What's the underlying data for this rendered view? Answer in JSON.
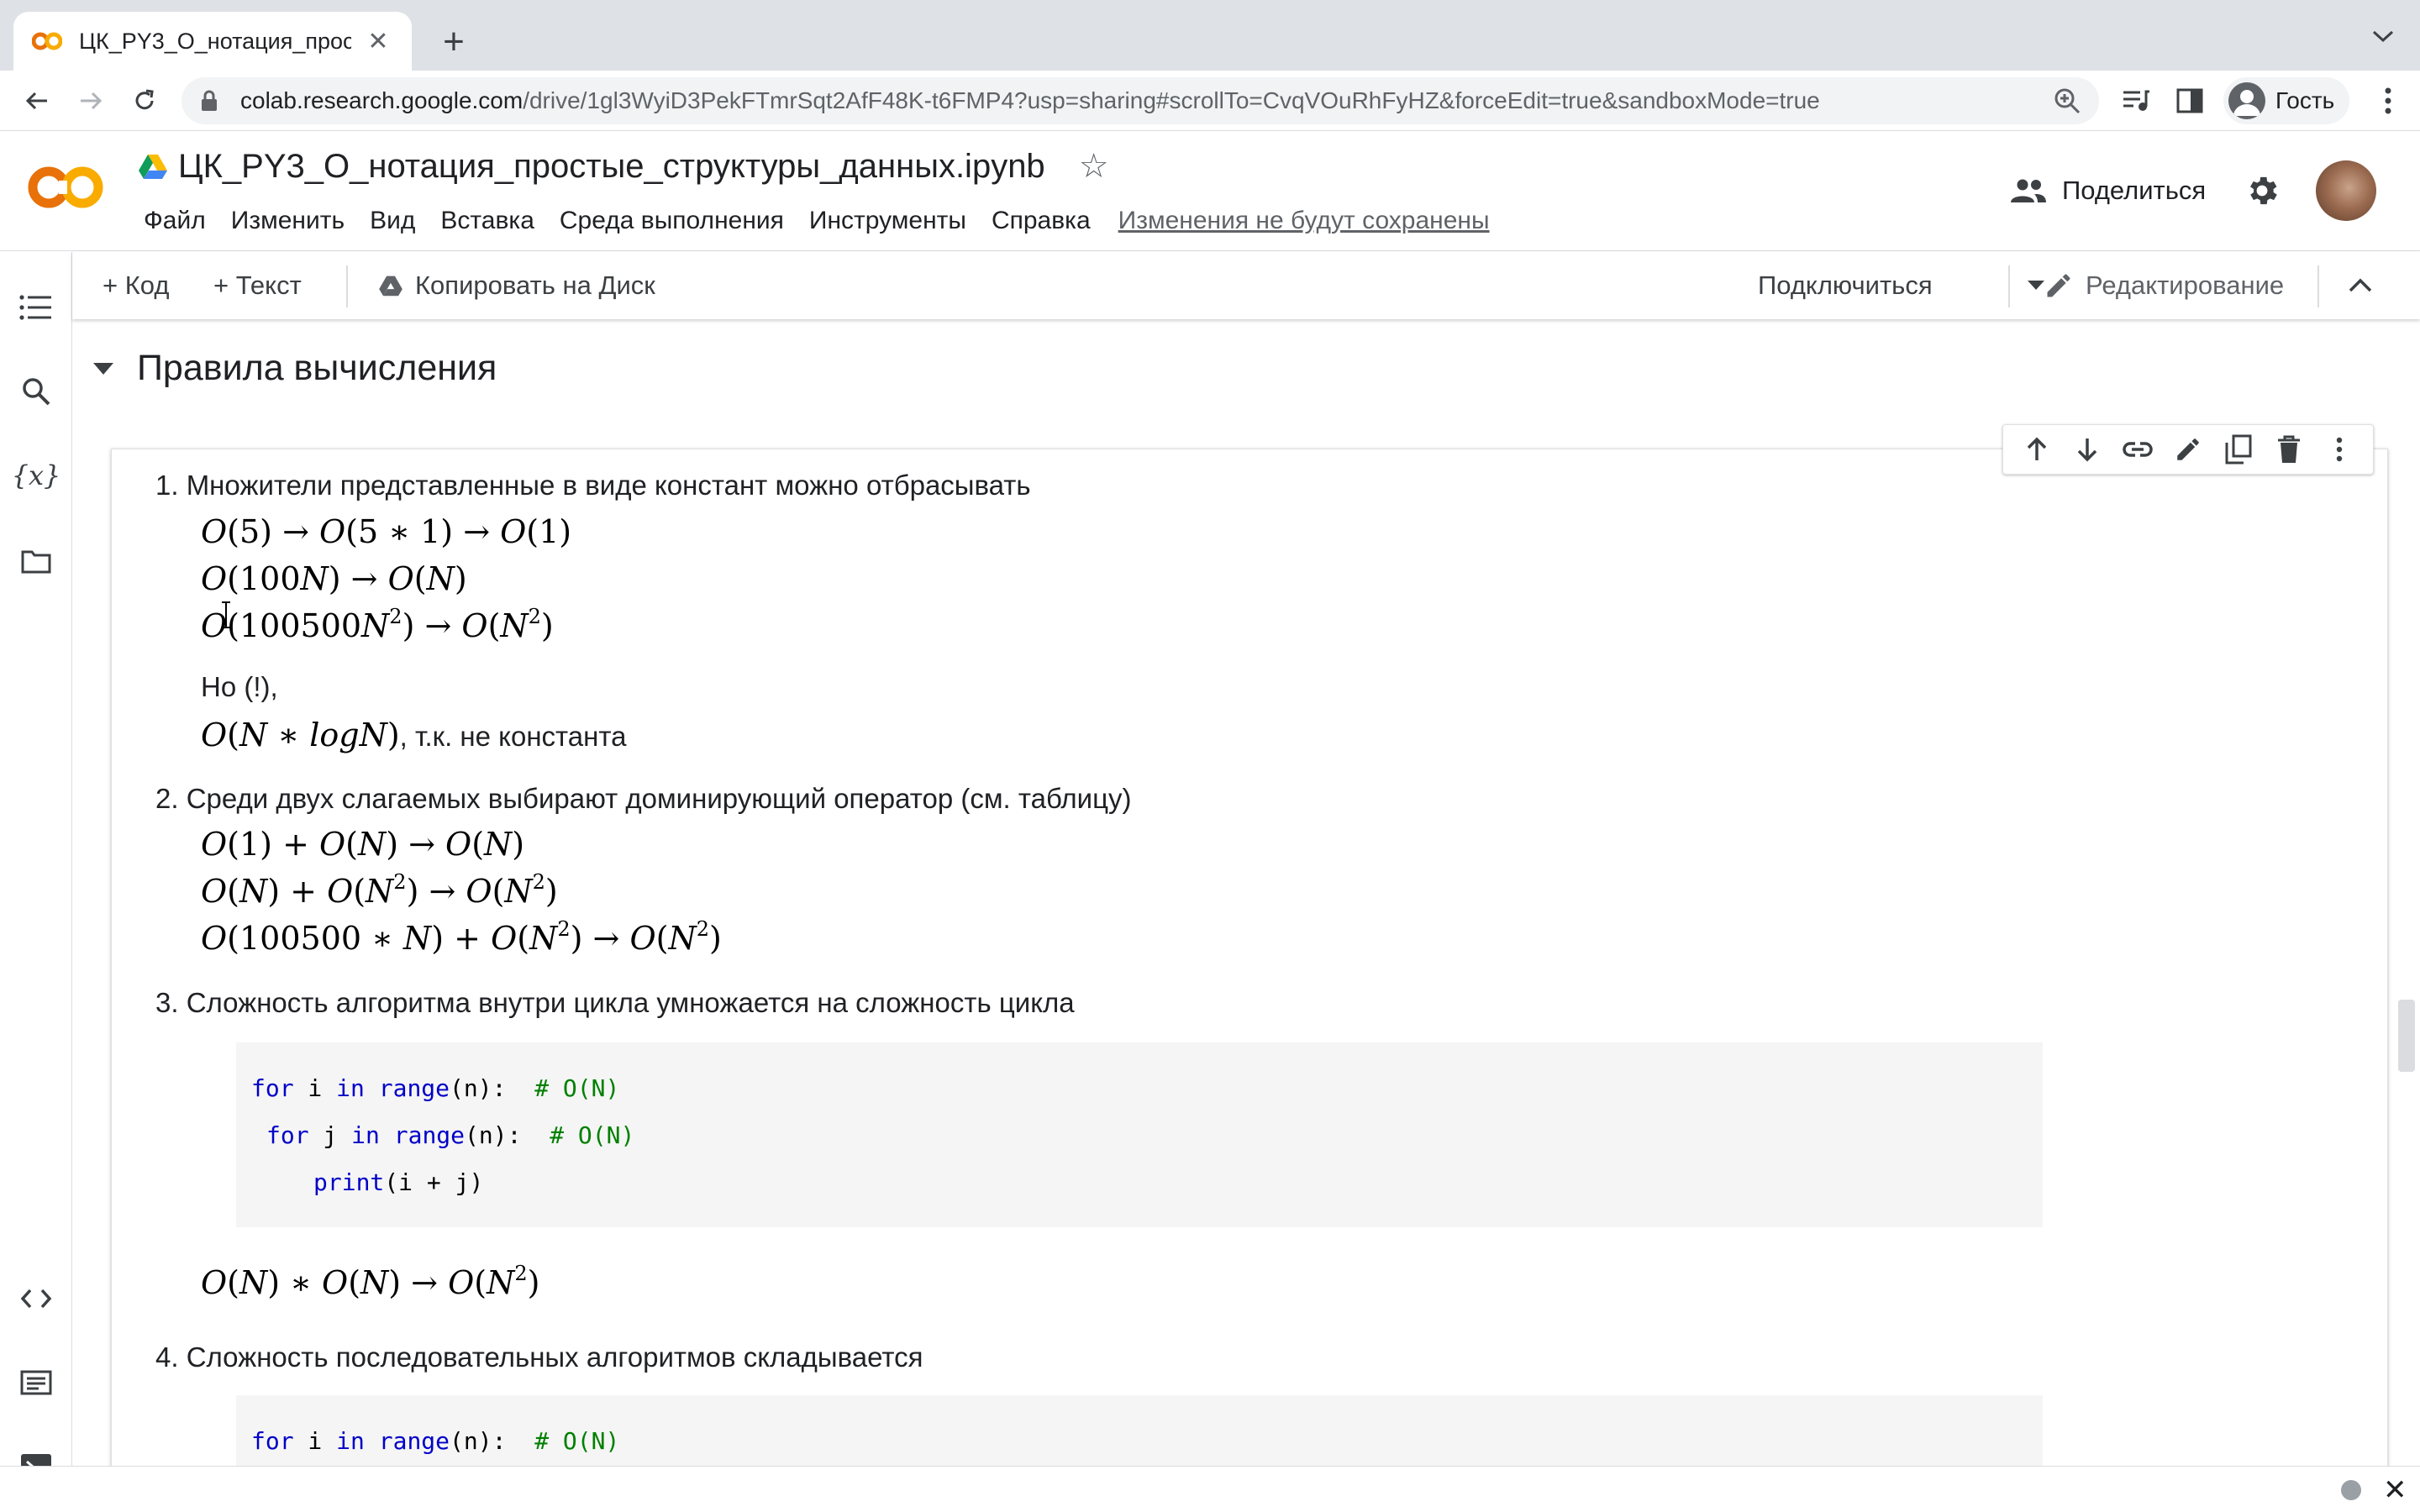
{
  "browser": {
    "tab_title": "ЦК_PY3_O_нотация_простые_структуры_данных.ipynb",
    "new_tab_symbol": "+",
    "close_symbol": "✕",
    "url_host": "colab.research.google.com",
    "url_path": "/drive/1gl3WyiD3PekFTmrSqt2AfF48K-t6FMP4?usp=sharing#scrollTo=CvqVOuRhFyHZ&forceEdit=true&sandboxMode=true",
    "guest_label": "Гость"
  },
  "header": {
    "logo_text": "CO",
    "title": "ЦК_PY3_O_нотация_простые_структуры_данных.ipynb",
    "menu": [
      "Файл",
      "Изменить",
      "Вид",
      "Вставка",
      "Среда выполнения",
      "Инструменты",
      "Справка"
    ],
    "unsaved_notice": "Изменения не будут сохранены",
    "share_label": "Поделиться"
  },
  "nb_toolbar": {
    "add_code": "+ Код",
    "add_text": "+ Текст",
    "copy_to_drive": "Копировать на Диск",
    "connect": "Подключиться",
    "editing": "Редактирование"
  },
  "section": {
    "title": "Правила вычисления"
  },
  "content": {
    "item1": "1. Множители представленные в виде констант можно отбрасывать",
    "but": "Но (!),",
    "not_const": ", т.к. не константа",
    "item2": "2. Среди двух слагаемых выбирают доминирующий оператор (см. таблицу)",
    "item3": "3. Сложность алгоритма внутри цикла умножается на сложность цикла",
    "item4": "4. Сложность последовательных алгоритмов складывается",
    "code1_comment": "# O(N)",
    "code2_comment": "# O(N)"
  },
  "colors": {
    "keyword": "#0000c8",
    "comment": "#008000",
    "colab_orange": "#f9ab00",
    "colab_orange_dark": "#e8710a"
  }
}
